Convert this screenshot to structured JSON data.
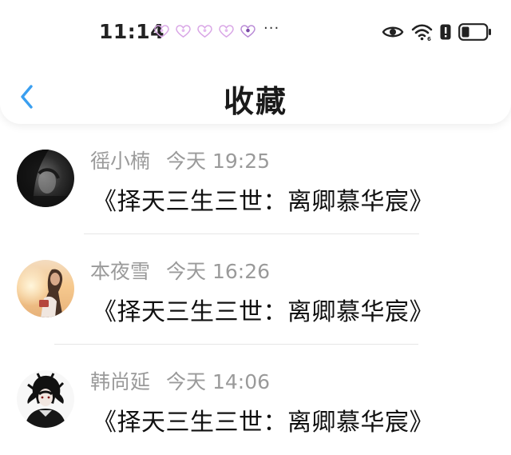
{
  "status_bar": {
    "time": "11:14",
    "notification_icons": [
      "heart-icon",
      "heart-icon",
      "heart-icon",
      "heart-icon",
      "heart-icon"
    ],
    "more": "···",
    "system_icons": [
      "eye-icon",
      "wifi-icon",
      "alert-icon",
      "battery-icon"
    ]
  },
  "header": {
    "back_icon": "chevron-left-icon",
    "title": "收藏",
    "accent_color": "#3a9ff0"
  },
  "favorites": [
    {
      "name": "徭小楠",
      "time": "今天 19:25",
      "message": "《择天三生三世：离卿慕华宸》",
      "avatar": "dark-portrait-avatar"
    },
    {
      "name": "本夜雪",
      "time": "今天 16:26",
      "message": "《择天三生三世：离卿慕华宸》",
      "avatar": "sunset-girl-avatar"
    },
    {
      "name": "韩尚延",
      "time": "今天 14:06",
      "message": "《择天三生三世：离卿慕华宸》",
      "avatar": "anime-boy-avatar"
    }
  ]
}
